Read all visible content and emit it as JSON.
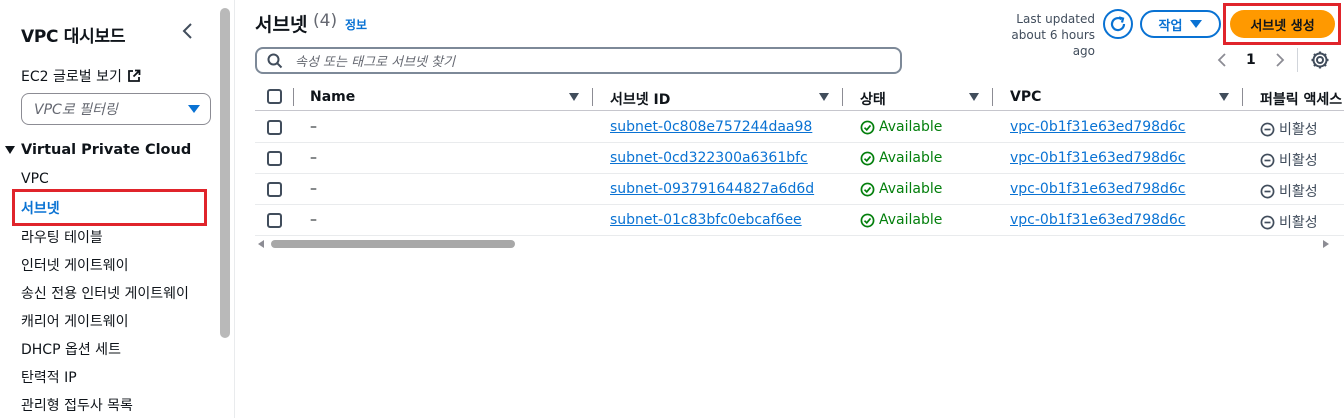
{
  "sidebar": {
    "title": "VPC 대시보드",
    "ec2_link": "EC2 글로벌 보기",
    "filter_placeholder": "VPC로 필터링",
    "section": "Virtual Private Cloud",
    "items": [
      {
        "label": "VPC"
      },
      {
        "label": "서브넷"
      },
      {
        "label": "라우팅 테이블"
      },
      {
        "label": "인터넷 게이트웨이"
      },
      {
        "label": "송신 전용 인터넷 게이트웨이"
      },
      {
        "label": "캐리어 게이트웨이"
      },
      {
        "label": "DHCP 옵션 세트"
      },
      {
        "label": "탄력적 IP"
      },
      {
        "label": "관리형 접두사 목록"
      }
    ],
    "active_item": "서브넷"
  },
  "header": {
    "title": "서브넷",
    "count": "(4)",
    "info": "정보",
    "last_updated_line1": "Last updated",
    "last_updated_line2": "about 6 hours ago",
    "actions_label": "작업",
    "create_label": "서브넷 생성"
  },
  "search": {
    "placeholder": "속성 또는 태그로 서브넷 찾기"
  },
  "pagination": {
    "page": "1"
  },
  "table": {
    "columns": [
      "Name",
      "서브넷 ID",
      "상태",
      "VPC",
      "퍼블릭 액세스"
    ],
    "rows": [
      {
        "name": "–",
        "subnet_id": "subnet-0c808e757244daa98",
        "status": "Available",
        "vpc": "vpc-0b1f31e63ed798d6c",
        "public": "비활성"
      },
      {
        "name": "–",
        "subnet_id": "subnet-0cd322300a6361bfc",
        "status": "Available",
        "vpc": "vpc-0b1f31e63ed798d6c",
        "public": "비활성"
      },
      {
        "name": "–",
        "subnet_id": "subnet-093791644827a6d6d",
        "status": "Available",
        "vpc": "vpc-0b1f31e63ed798d6c",
        "public": "비활성"
      },
      {
        "name": "–",
        "subnet_id": "subnet-01c83bfc0ebcaf6ee",
        "status": "Available",
        "vpc": "vpc-0b1f31e63ed798d6c",
        "public": "비활성"
      }
    ]
  },
  "colors": {
    "accent": "#0972d3",
    "primary_button": "#ff9900",
    "highlight_box": "#e0242b",
    "status_ok": "#037f0c"
  },
  "icons": {
    "external": "external-link-icon",
    "refresh": "refresh-icon",
    "search": "search-icon",
    "settings": "gear-icon",
    "status": "check-circle-icon",
    "public": "minus-circle-icon"
  }
}
